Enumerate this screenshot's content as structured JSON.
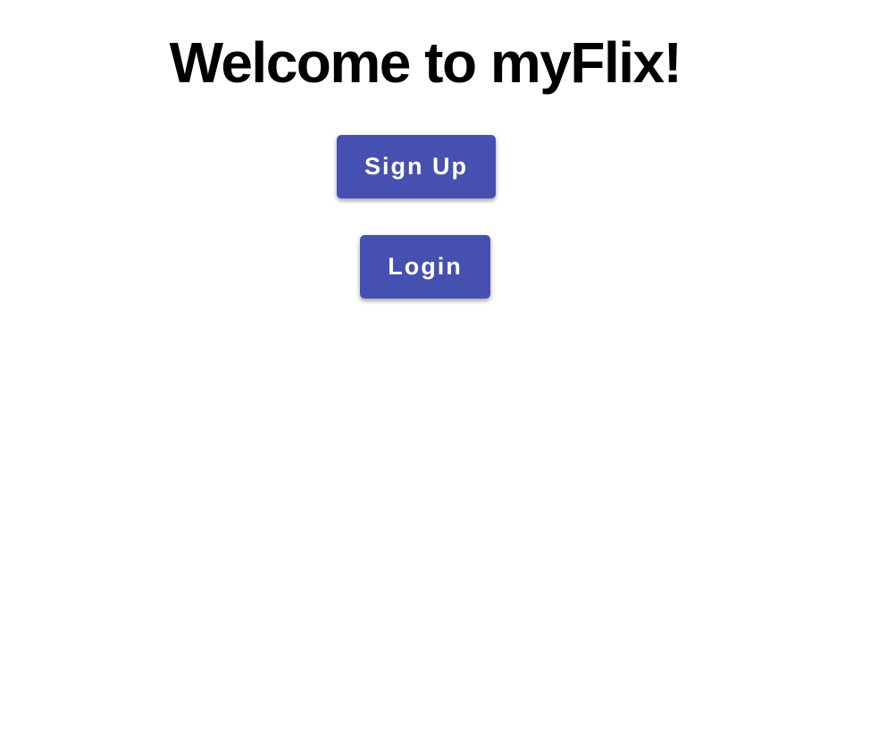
{
  "page": {
    "title": "Welcome to myFlix!"
  },
  "actions": {
    "signup_label": "Sign Up",
    "login_label": "Login"
  },
  "colors": {
    "button_background": "#4650b0",
    "button_text": "#ffffff",
    "title_text": "#000000",
    "page_background": "#ffffff"
  }
}
